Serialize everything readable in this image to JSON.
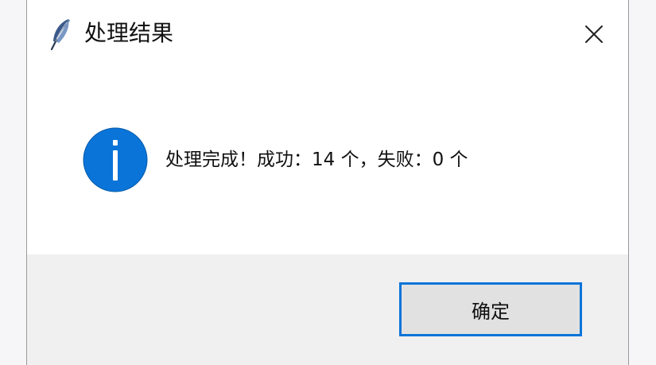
{
  "window": {
    "title": "处理结果",
    "icon": "feather-icon",
    "close_icon": "close-icon"
  },
  "message": {
    "icon": "info-icon",
    "text": "处理完成！成功：14 个，失败：0 个"
  },
  "buttons": {
    "ok_label": "确定"
  },
  "colors": {
    "info_blue": "#0a74d8",
    "focus_border": "#0a74d8",
    "button_bg": "#e1e1e1",
    "footer_bg": "#f0f0f0"
  }
}
